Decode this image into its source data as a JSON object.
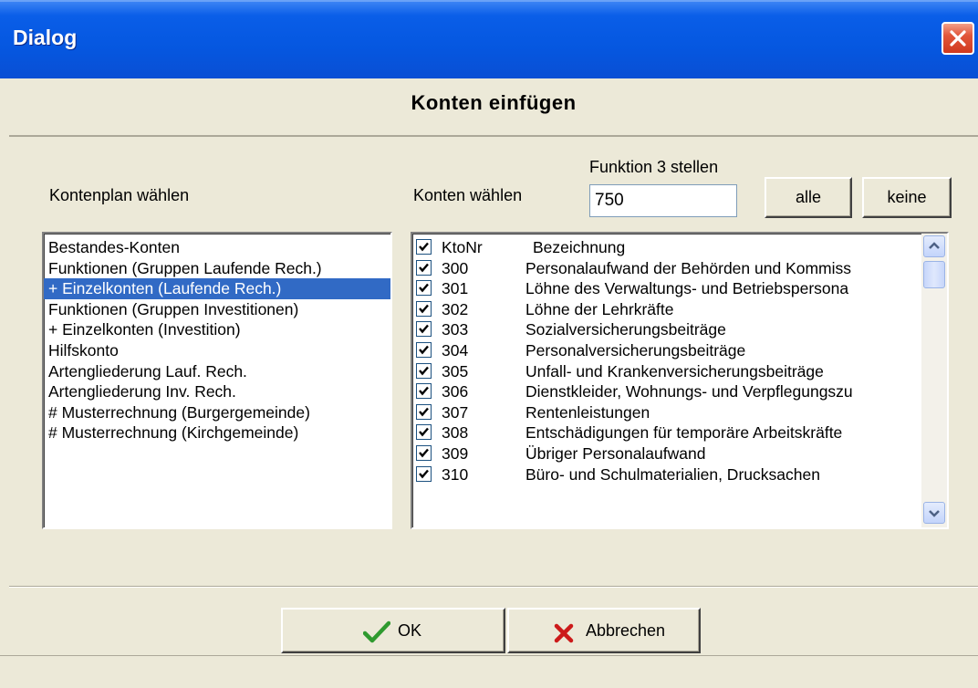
{
  "window": {
    "title": "Dialog"
  },
  "header": {
    "title": "Konten einfügen"
  },
  "plan": {
    "label": "Kontenplan wählen",
    "items": [
      "Bestandes-Konten",
      "Funktionen (Gruppen Laufende Rech.)",
      "+  Einzelkonten (Laufende Rech.)",
      "Funktionen (Gruppen Investitionen)",
      "+  Einzelkonten (Investition)",
      "Hilfskonto",
      "Artengliederung Lauf. Rech.",
      "Artengliederung Inv. Rech.",
      "#  Musterrechnung (Burgergemeinde)",
      "#  Musterrechnung  (Kirchgemeinde)"
    ],
    "selected_index": 2
  },
  "accounts": {
    "label": "Konten wählen",
    "function_label": "Funktion 3 stellen",
    "function_value": "750",
    "all_button": "alle",
    "none_button": "keine",
    "columns": {
      "nr": "KtoNr",
      "desc": "Bezeichnung"
    },
    "rows": [
      {
        "nr": "300",
        "desc": "Personalaufwand der Behörden und Kommiss",
        "checked": true
      },
      {
        "nr": "301",
        "desc": "Löhne des Verwaltungs- und Betriebspersona",
        "checked": true
      },
      {
        "nr": "302",
        "desc": "Löhne der Lehrkräfte",
        "checked": true
      },
      {
        "nr": "303",
        "desc": "Sozialversicherungsbeiträge",
        "checked": true
      },
      {
        "nr": "304",
        "desc": "Personalversicherungsbeiträge",
        "checked": true
      },
      {
        "nr": "305",
        "desc": "Unfall- und Krankenversicherungsbeiträge",
        "checked": true
      },
      {
        "nr": "306",
        "desc": "Dienstkleider, Wohnungs- und Verpflegungszu",
        "checked": true
      },
      {
        "nr": "307",
        "desc": "Rentenleistungen",
        "checked": true
      },
      {
        "nr": "308",
        "desc": "Entschädigungen für temporäre Arbeitskräfte",
        "checked": true
      },
      {
        "nr": "309",
        "desc": "Übriger Personalaufwand",
        "checked": true
      },
      {
        "nr": "310",
        "desc": "Büro- und Schulmaterialien, Drucksachen",
        "checked": true
      }
    ]
  },
  "footer": {
    "ok_label": "OK",
    "cancel_label": "Abbrechen"
  },
  "colors": {
    "selection": "#316ac5",
    "titlebar": "#0a5ee8",
    "face": "#ece9d8"
  }
}
